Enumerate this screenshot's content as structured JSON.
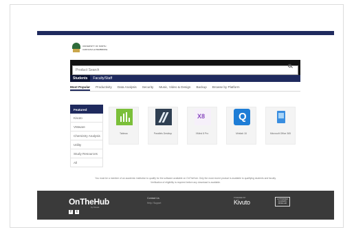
{
  "logo": {
    "line1": "UNIVERSITY OF NORTH",
    "line2": "CAROLINA at PEMBROKE"
  },
  "search": {
    "placeholder": "Product Search"
  },
  "audience_tabs": [
    {
      "label": "Students",
      "active": true
    },
    {
      "label": "Faculty/Staff",
      "active": false
    }
  ],
  "category_tabs": [
    {
      "label": "Most Popular",
      "active": true
    },
    {
      "label": "Productivity",
      "active": false
    },
    {
      "label": "Data Analysis",
      "active": false
    },
    {
      "label": "Security",
      "active": false
    },
    {
      "label": "Music, Video & Design",
      "active": false
    },
    {
      "label": "Backup",
      "active": false
    },
    {
      "label": "Browse by Platform",
      "active": false
    }
  ],
  "sidebar": {
    "items": [
      {
        "label": "Featured",
        "active": true
      },
      {
        "label": "Kivuto",
        "active": false
      },
      {
        "label": "VMware",
        "active": false
      },
      {
        "label": "Chemistry Analysis",
        "active": false
      },
      {
        "label": "Utility",
        "active": false
      },
      {
        "label": "Study Resources",
        "active": false
      },
      {
        "label": "All",
        "active": false
      }
    ]
  },
  "products": [
    {
      "name": "Tableau",
      "icon": "bar-chart-icon"
    },
    {
      "name": "Parallels Desktop",
      "icon": "stripes-icon"
    },
    {
      "name": "XMind 8 Pro",
      "icon": "xmind-icon"
    },
    {
      "name": "Minitab 18",
      "icon": "q-icon"
    },
    {
      "name": "Microsoft Office 365",
      "icon": "software-box-icon"
    }
  ],
  "notice": {
    "line1": "You must be a member of an academic institution to qualify for the software available on OnTheHub. Only the most recent product is available to qualifying students and faculty.",
    "line2": "Verification of eligibility is required before any download is available."
  },
  "footer": {
    "brand": "OnTheHub",
    "brand_by": "by Kivuto",
    "social": [
      "f",
      "t"
    ],
    "col_heading": "Contact Us",
    "col_link": "Help / Support",
    "powered_label": "POWERED BY",
    "kivuto": "Kivuto",
    "badge_lines": [
      "AUTHORIZED",
      "ACADEMIC",
      "RESELLER"
    ]
  },
  "colors": {
    "navy": "#1f2a5e",
    "footer": "#3a3a3a"
  }
}
